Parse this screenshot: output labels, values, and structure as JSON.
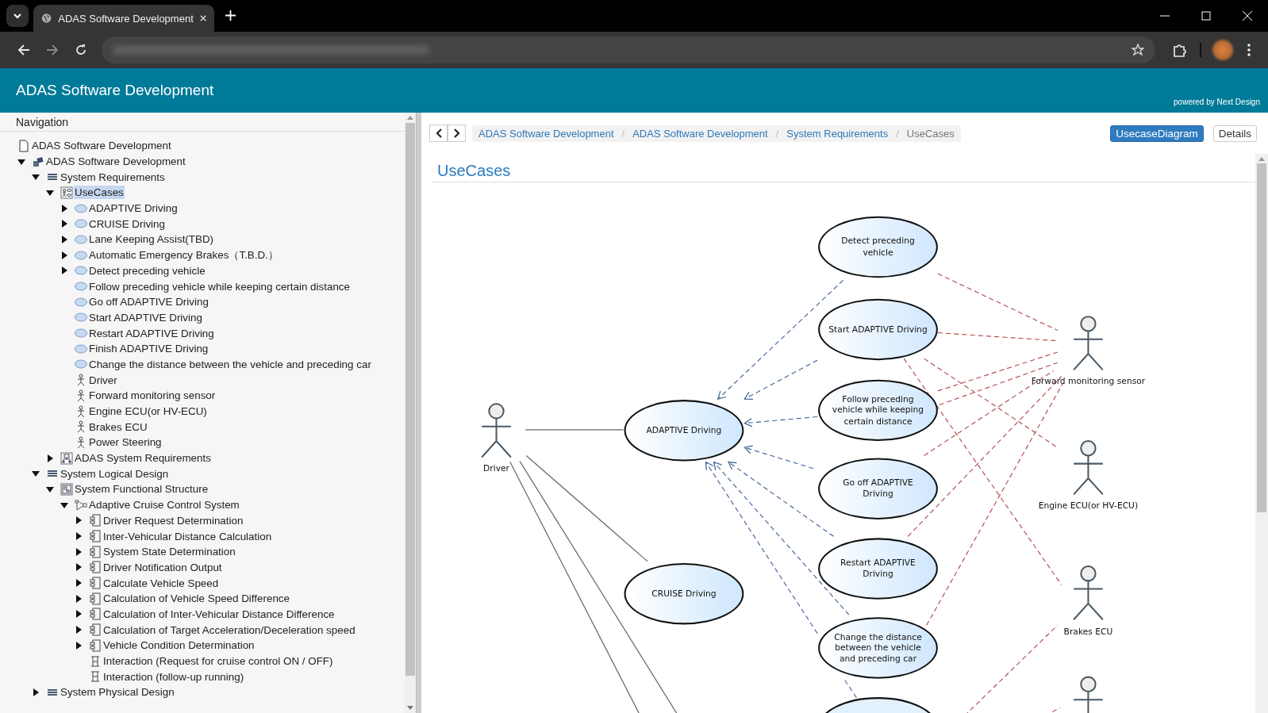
{
  "browser": {
    "tab_title": "ADAS Software Development"
  },
  "header": {
    "title": "ADAS Software Development",
    "powered_by": "powered by Next Design"
  },
  "navigation": {
    "title": "Navigation",
    "tree": [
      {
        "label": "ADAS Software Development",
        "kind": "document",
        "selected": false
      },
      {
        "label": "ADAS Software Development",
        "kind": "project",
        "expanded": true,
        "selected": false,
        "children": [
          {
            "label": "System Requirements",
            "kind": "model",
            "expanded": true,
            "selected": false,
            "children": [
              {
                "label": "UseCases",
                "kind": "usecasediagram",
                "expanded": true,
                "selected": true,
                "children": [
                  {
                    "label": "ADAPTIVE Driving",
                    "kind": "usecase",
                    "expanded": false,
                    "selected": false
                  },
                  {
                    "label": "CRUISE Driving",
                    "kind": "usecase",
                    "expanded": false,
                    "selected": false
                  },
                  {
                    "label": "Lane Keeping Assist(TBD)",
                    "kind": "usecase",
                    "expanded": false,
                    "selected": false
                  },
                  {
                    "label": "Automatic Emergency Brakes（T.B.D.）",
                    "kind": "usecase",
                    "expanded": false,
                    "selected": false
                  },
                  {
                    "label": "Detect preceding vehicle",
                    "kind": "usecase",
                    "expanded": false,
                    "selected": false
                  },
                  {
                    "label": "Follow preceding vehicle while keeping certain distance",
                    "kind": "usecase",
                    "selected": false
                  },
                  {
                    "label": "Go off ADAPTIVE Driving",
                    "kind": "usecase",
                    "selected": false
                  },
                  {
                    "label": "Start ADAPTIVE Driving",
                    "kind": "usecase",
                    "selected": false
                  },
                  {
                    "label": "Restart ADAPTIVE Driving",
                    "kind": "usecase",
                    "selected": false
                  },
                  {
                    "label": "Finish ADAPTIVE Driving",
                    "kind": "usecase",
                    "selected": false
                  },
                  {
                    "label": "Change the distance between the vehicle and preceding car",
                    "kind": "usecase",
                    "selected": false
                  },
                  {
                    "label": "Driver",
                    "kind": "actor",
                    "selected": false
                  },
                  {
                    "label": "Forward monitoring sensor",
                    "kind": "actor",
                    "selected": false
                  },
                  {
                    "label": "Engine ECU(or HV-ECU)",
                    "kind": "actor",
                    "selected": false
                  },
                  {
                    "label": "Brakes ECU",
                    "kind": "actor",
                    "selected": false
                  },
                  {
                    "label": "Power Steering",
                    "kind": "actor",
                    "selected": false
                  }
                ]
              },
              {
                "label": "ADAS System Requirements",
                "kind": "hierarchy",
                "expanded": false,
                "selected": false
              }
            ]
          },
          {
            "label": "System Logical Design",
            "kind": "model",
            "expanded": true,
            "selected": false,
            "children": [
              {
                "label": "System Functional Structure",
                "kind": "structure",
                "expanded": true,
                "selected": false,
                "children": [
                  {
                    "label": "Adaptive Cruise Control System",
                    "kind": "system",
                    "expanded": true,
                    "selected": false,
                    "children": [
                      {
                        "label": "Driver Request Determination",
                        "kind": "component",
                        "expanded": false,
                        "selected": false
                      },
                      {
                        "label": "Inter-Vehicular Distance Calculation",
                        "kind": "component",
                        "expanded": false,
                        "selected": false
                      },
                      {
                        "label": "System State Determination",
                        "kind": "component",
                        "expanded": false,
                        "selected": false
                      },
                      {
                        "label": "Driver Notification Output",
                        "kind": "component",
                        "expanded": false,
                        "selected": false
                      },
                      {
                        "label": "Calculate Vehicle Speed",
                        "kind": "component",
                        "expanded": false,
                        "selected": false
                      },
                      {
                        "label": "Calculation of Vehicle Speed Difference",
                        "kind": "component",
                        "expanded": false,
                        "selected": false
                      },
                      {
                        "label": "Calculation of Inter-Vehicular Distance Difference",
                        "kind": "component",
                        "expanded": false,
                        "selected": false
                      },
                      {
                        "label": "Calculation of Target Acceleration/Deceleration speed",
                        "kind": "component",
                        "expanded": false,
                        "selected": false
                      },
                      {
                        "label": "Vehicle Condition Determination",
                        "kind": "component",
                        "expanded": false,
                        "selected": false
                      },
                      {
                        "label": "Interaction (Request for cruise control ON / OFF)",
                        "kind": "interaction",
                        "selected": false
                      },
                      {
                        "label": "Interaction (follow-up running)",
                        "kind": "interaction",
                        "selected": false
                      }
                    ]
                  }
                ]
              }
            ]
          },
          {
            "label": "System Physical Design",
            "kind": "model",
            "expanded": false,
            "selected": false
          }
        ]
      }
    ]
  },
  "breadcrumb": {
    "items": [
      "ADAS Software Development",
      "ADAS Software Development",
      "System Requirements",
      "UseCases"
    ],
    "separators": [
      "/",
      "/",
      "/"
    ]
  },
  "view_buttons": [
    {
      "label": "UsecaseDiagram",
      "selected": true
    },
    {
      "label": "Details",
      "selected": false
    }
  ],
  "page_title": "UseCases",
  "diagram": {
    "use_cases": [
      "Detect preceding vehicle",
      "Start ADAPTIVE Driving",
      "Follow preceding vehicle while keeping certain distance",
      "ADAPTIVE Driving",
      "Go off ADAPTIVE Driving",
      "Restart ADAPTIVE Driving",
      "CRUISE Driving",
      "Change the distance between the vehicle and preceding car"
    ],
    "actors": [
      "Driver",
      "Forward monitoring sensor",
      "Engine ECU(or HV-ECU)",
      "Brakes ECU"
    ]
  }
}
